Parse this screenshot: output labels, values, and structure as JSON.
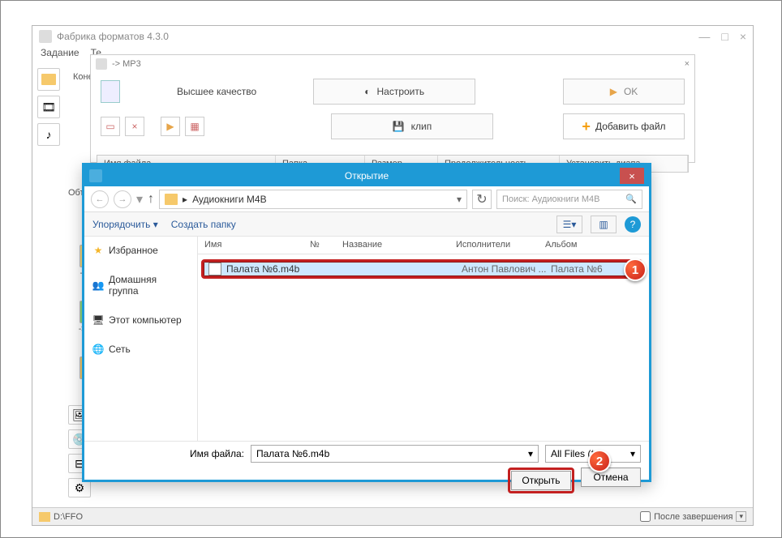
{
  "app": {
    "title": "Фабрика форматов 4.3.0",
    "menu": {
      "task": "Задание",
      "te": "Те"
    },
    "win": {
      "min": "—",
      "max": "□",
      "close": "×"
    }
  },
  "sidebar": {
    "dest_label": "Конечн",
    "objects_label": "Объе",
    "formats": {
      "mp3": "-> MP",
      "flac": "-> FLA",
      "mmf": ""
    }
  },
  "inner": {
    "title": "-> MP3",
    "quality": "Высшее качество",
    "configure": "Настроить",
    "ok": "OK",
    "clip": "клип",
    "add_file": "Добавить файл",
    "close": "×"
  },
  "table": {
    "col_name": "Имя файла",
    "col_folder": "Папка",
    "col_size": "Размер",
    "col_duration": "Продолжительность",
    "col_range": "Установить диапа..."
  },
  "dialog": {
    "title": "Открытие",
    "breadcrumb_sep": "▸",
    "breadcrumb": "Аудиокниги M4B",
    "refresh": "↻",
    "search_placeholder": "Поиск: Аудиокниги M4B",
    "organize": "Упорядочить ▾",
    "new_folder": "Создать папку",
    "help": "?",
    "tree": {
      "favorites": "Избранное",
      "homegroup": "Домашняя группа",
      "this_pc": "Этот компьютер",
      "network": "Сеть"
    },
    "cols": {
      "name": "Имя",
      "num": "№",
      "title": "Название",
      "artists": "Исполнители",
      "album": "Альбом"
    },
    "file": {
      "name": "Палата №6.m4b",
      "artist": "Антон Павлович ...",
      "album": "Палата №6"
    },
    "fn_label": "Имя файла:",
    "fn_value": "Палата №6.m4b",
    "filter": "All Files (*.*)",
    "open": "Открыть",
    "cancel": "Отмена",
    "close": "×",
    "dropdown": "▾"
  },
  "status": {
    "path": "D:\\FFO",
    "after_label": "После завершения"
  },
  "badges": {
    "one": "1",
    "two": "2"
  }
}
